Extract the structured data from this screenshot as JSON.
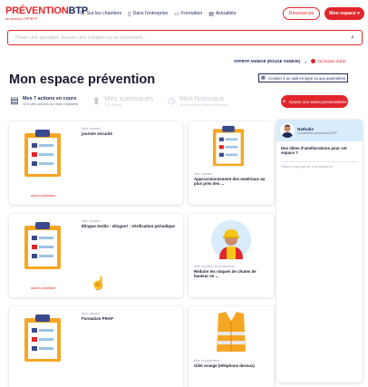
{
  "header": {
    "logo_red": "PRÉVENTION",
    "logo_dark": "BTP",
    "logo_sub": "au service OPPBTP",
    "nav": [
      {
        "icon": "construction-site-icon",
        "label": "Sur les chantiers"
      },
      {
        "icon": "office-icon",
        "label": "Dans l'entreprise"
      },
      {
        "icon": "monitor-icon",
        "label": "Formation"
      },
      {
        "icon": "news-icon",
        "label": "Actualités"
      }
    ],
    "resources_label": "Ressources",
    "my_space_label": "Mon espace ▾"
  },
  "search": {
    "placeholder": "Poser une question, trouver une solution ou un document..."
  },
  "org": {
    "name": "OPPBTP ANNEXE (ROUGE ANNEXE)",
    "help_label": "J'ai besoin d'aide"
  },
  "page": {
    "title": "Mon espace prévention",
    "tool_link": "Accéder à un outil en ligne ou aux paramètres"
  },
  "tabs": [
    {
      "title": "Mes 7 actions en cours",
      "sub": "11% des actions du mois réalisées",
      "active": true
    },
    {
      "title": "Mes statistiques",
      "sub": "312 points",
      "active": false
    },
    {
      "title": "Mon historique",
      "sub": "36 nouvelles actions réalisées",
      "active": false
    }
  ],
  "add_action_label": "Ajouter une action personnalisée",
  "cards": [
    {
      "category": "Mon dossier",
      "title": "journée sécurité",
      "tag": "Action prioritaire"
    },
    {
      "category": "Mon dossier",
      "title": "Approvisionnement des matériaux au plus près des ...",
      "tag": ""
    },
    {
      "category": "Mon dossier",
      "title": "Élingue textile - elingue7 : Vérification périodique",
      "tag": "Action prioritaire"
    },
    {
      "category": "Mon espace de prévention",
      "title": "Réduire les risques de chutes de hauteur en ...",
      "tag": ""
    },
    {
      "category": "Mon dossier",
      "title": "Formation PRAP",
      "tag": ""
    },
    {
      "category": "Mon équipement",
      "title": "Gilet orange (téléphone dessus)",
      "tag": ""
    }
  ],
  "chat": {
    "name": "Nathalie",
    "role": "Conseillère prévention BTP",
    "message": "Des idées d'améliorations pour cet espace ?",
    "input_placeholder": "Faites nous part de vos retours ici"
  },
  "colors": {
    "brand_red": "#e1252a",
    "brand_dark": "#1f2a5a",
    "chat_head": "#d8ecfb"
  }
}
